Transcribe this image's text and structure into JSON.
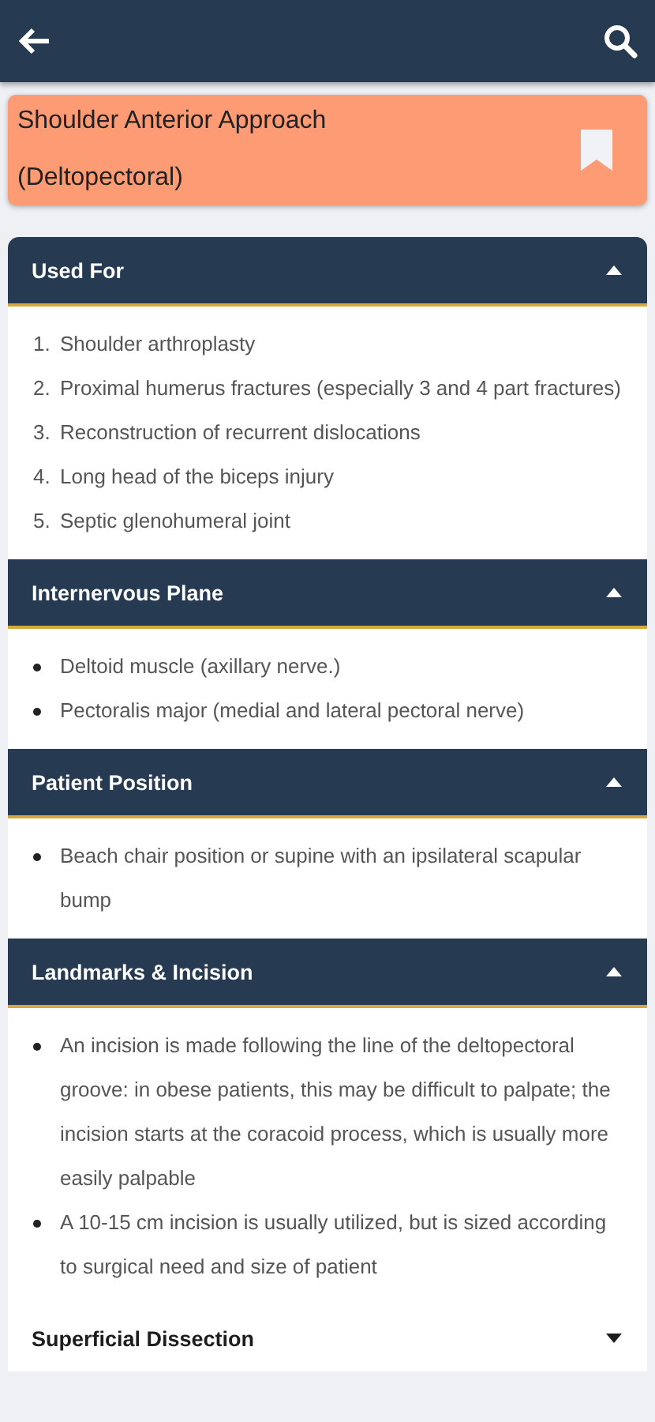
{
  "title": "Shoulder Anterior Approach (Deltopectoral)",
  "bookmarked": false,
  "sections": [
    {
      "heading": "Used For",
      "expanded": true,
      "kind": "ordered",
      "items": [
        {
          "number": "1.",
          "text": "Shoulder arthroplasty"
        },
        {
          "number": "2.",
          "text": "Proximal humerus fractures (especially 3 and 4 part fractures)"
        },
        {
          "number": "3.",
          "text": "Reconstruction of recurrent dislocations"
        },
        {
          "number": "4.",
          "text": "Long head of the biceps injury"
        },
        {
          "number": "5.",
          "text": "Septic glenohumeral joint"
        }
      ]
    },
    {
      "heading": "Internervous Plane",
      "expanded": true,
      "kind": "bulleted",
      "items": [
        {
          "text": "Deltoid muscle (axillary nerve.)"
        },
        {
          "text": "Pectoralis major (medial and lateral pectoral nerve)"
        }
      ]
    },
    {
      "heading": "Patient Position",
      "expanded": true,
      "kind": "bulleted",
      "items": [
        {
          "text": "Beach chair position or supine with an ipsilateral scapular bump"
        }
      ]
    },
    {
      "heading": "Landmarks & Incision",
      "expanded": true,
      "kind": "bulleted",
      "items": [
        {
          "text": "An incision is made following the line of the deltopectoral groove: in obese patients, this may be difficult to palpate; the incision starts at the coracoid process, which is usually more easily palpable"
        },
        {
          "text": "A 10-15 cm incision is usually utilized, but is sized according to surgical need and size of patient"
        }
      ]
    },
    {
      "heading": "Superficial Dissection",
      "expanded": false
    }
  ]
}
